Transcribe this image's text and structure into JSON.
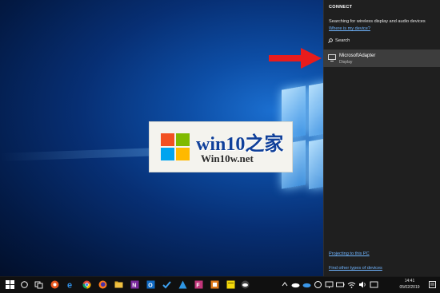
{
  "watermark": {
    "title": "win10之家",
    "subtitle": "Win10w.net"
  },
  "connect_panel": {
    "title": "CONNECT",
    "status": "Searching for wireless display and audio devices",
    "where_link": "Where is my device?",
    "search_label": "Search",
    "device": {
      "name": "MicrosoftAdapter",
      "type": "Display"
    },
    "projecting_link": "Projecting to this PC",
    "other_link": "Find other types of devices"
  },
  "taskbar": {
    "icons": [
      "windows-start-icon",
      "search-circle-icon",
      "task-view-icon",
      "app-orange-icon",
      "edge-icon",
      "chrome-icon",
      "firefox-icon",
      "file-explorer-icon",
      "onenote-icon",
      "outlook-icon",
      "todo-icon",
      "azure-icon",
      "app-tile-icon",
      "app-tile-orange-icon",
      "sticky-notes-icon",
      "app-cloud-icon"
    ],
    "clock_time": "14:41",
    "clock_date": "05/02/2019"
  },
  "colors": {
    "panel_bg": "#1f1f1f",
    "link": "#6fb4ff",
    "selected_device_bg": "#3d3d3d",
    "arrow": "#e81c1c"
  }
}
